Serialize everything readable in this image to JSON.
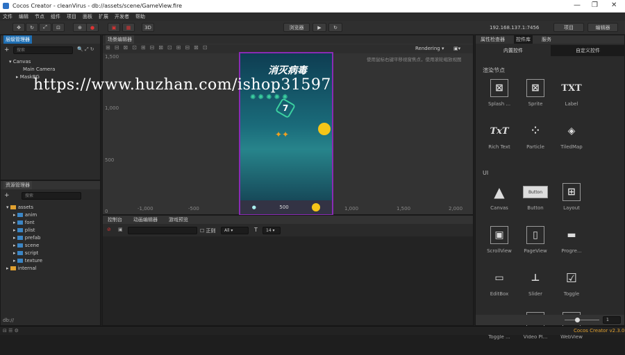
{
  "app": {
    "title": "Cocos Creator - cleanVirus - db://assets/scene/GameView.fire",
    "version_label": "Cocos Creator v2.3.0",
    "window_controls": [
      "—",
      "❐",
      "✕"
    ]
  },
  "menu": [
    "文件",
    "编辑",
    "节点",
    "组件",
    "项目",
    "面板",
    "扩展",
    "开发者",
    "帮助"
  ],
  "toolbar": {
    "mode_3d": "3D",
    "preview_select": "浏览器",
    "ip": "192.168.137.1:7456",
    "project_btn": "项目",
    "editor_btn": "编辑器"
  },
  "hierarchy": {
    "tab": "层级管理器",
    "search_placeholder": "搜索",
    "nodes": [
      "Canvas",
      "Main Camera",
      "MaskBG"
    ]
  },
  "assets": {
    "tab": "资源管理器",
    "search_placeholder": "搜索",
    "root": "assets",
    "folders": [
      "anim",
      "font",
      "plist",
      "prefab",
      "scene",
      "script",
      "texture"
    ],
    "internal": "internal",
    "path": "db://"
  },
  "scene": {
    "tab": "场景编辑器",
    "rendering": "Rendering",
    "hint": "使用鼠标右键平移视窗焦点，使用滚轮缩放视图",
    "y_labels": [
      "1,500",
      "1,000",
      "500",
      "0"
    ],
    "x_labels": [
      "-1,000",
      "-500",
      "0",
      "500",
      "1,000",
      "1,500",
      "2,000"
    ],
    "game_title": "消灭病毒",
    "game_score": "500",
    "game_badge": "7"
  },
  "console": {
    "tabs": [
      "控制台",
      "动画编辑器",
      "游戏预览"
    ],
    "regex_label": "正则",
    "level": "All",
    "font_size": "14"
  },
  "right": {
    "tabs": [
      "属性检查器",
      "控件库",
      "服务"
    ],
    "subtabs": [
      "内置控件",
      "自定义控件"
    ],
    "section_render": "渲染节点",
    "section_ui": "UI",
    "render_items": [
      {
        "label": "Splash ...",
        "glyph": "⊠"
      },
      {
        "label": "Sprite",
        "glyph": "⊠"
      },
      {
        "label": "Label",
        "glyph": "TXT"
      },
      {
        "label": "Rich Text",
        "glyph": "TxT"
      },
      {
        "label": "Particle",
        "glyph": "⁘"
      },
      {
        "label": "TiledMap",
        "glyph": "◈"
      }
    ],
    "ui_items": [
      {
        "label": "Canvas",
        "glyph": "▲"
      },
      {
        "label": "Button",
        "glyph": "Button"
      },
      {
        "label": "Layout",
        "glyph": "⊞"
      },
      {
        "label": "ScrollView",
        "glyph": "▣"
      },
      {
        "label": "PageView",
        "glyph": "▯"
      },
      {
        "label": "Progre...",
        "glyph": "▬"
      },
      {
        "label": "EditBox",
        "glyph": "▭"
      },
      {
        "label": "Slider",
        "glyph": "⊥"
      },
      {
        "label": "Toggle",
        "glyph": "☑"
      },
      {
        "label": "Toggle ...",
        "glyph": "☰"
      },
      {
        "label": "Video Pl...",
        "glyph": "▶"
      },
      {
        "label": "WebView",
        "glyph": "e"
      }
    ],
    "zoom_value": "1"
  },
  "watermark": "https://www.huzhan.com/ishop31597"
}
